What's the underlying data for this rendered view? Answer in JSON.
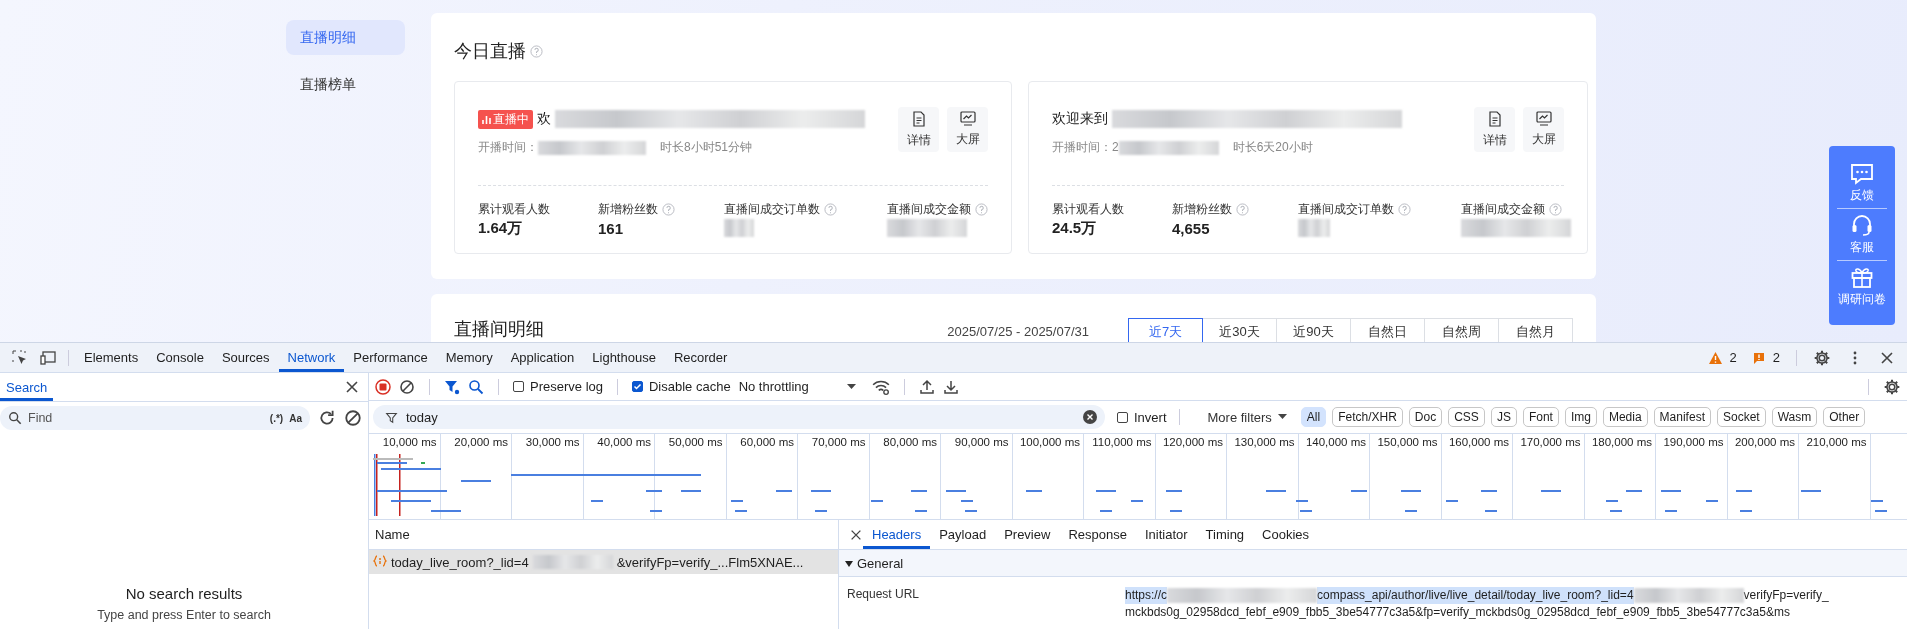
{
  "sidebar": {
    "items": [
      {
        "label": "直播明细",
        "selected": true
      },
      {
        "label": "直播榜单",
        "selected": false
      }
    ]
  },
  "today_live": {
    "title": "今日直播",
    "rooms": [
      {
        "live_badge": "直播中",
        "title": "欢",
        "start_label": "开播时间：",
        "duration": "时长8小时51分钟",
        "actions": [
          {
            "label": "详情",
            "kind": "detail"
          },
          {
            "label": "大屏",
            "kind": "screen"
          }
        ],
        "stats": [
          {
            "label": "累计观看人数",
            "value": "1.64万",
            "help": false
          },
          {
            "label": "新增粉丝数",
            "value": "161",
            "help": true
          },
          {
            "label": "直播间成交订单数",
            "help": true
          },
          {
            "label": "直播间成交金额",
            "help": true
          }
        ]
      },
      {
        "title": "欢迎来到",
        "start_label": "开播时间：2",
        "duration": "时长6天20小时",
        "actions": [
          {
            "label": "详情",
            "kind": "detail"
          },
          {
            "label": "大屏",
            "kind": "screen"
          }
        ],
        "stats": [
          {
            "label": "累计观看人数",
            "value": "24.5万",
            "help": false
          },
          {
            "label": "新增粉丝数",
            "value": "4,655",
            "help": true
          },
          {
            "label": "直播间成交订单数",
            "help": true
          },
          {
            "label": "直播间成交金额",
            "help": true
          }
        ]
      }
    ]
  },
  "live_detail": {
    "title": "直播间明细",
    "date_range": "2025/07/25 - 2025/07/31",
    "ranges": [
      {
        "label": "近7天",
        "selected": true
      },
      {
        "label": "近30天",
        "selected": false
      },
      {
        "label": "近90天",
        "selected": false
      },
      {
        "label": "自然日",
        "selected": false
      },
      {
        "label": "自然周",
        "selected": false
      },
      {
        "label": "自然月",
        "selected": false
      }
    ]
  },
  "float_bar": {
    "items": [
      {
        "label": "反馈",
        "kind": "chat"
      },
      {
        "label": "客服",
        "kind": "headset"
      },
      {
        "label": "调研问卷",
        "kind": "gift"
      }
    ]
  },
  "devtools": {
    "tabs": [
      {
        "label": "Elements",
        "selected": false
      },
      {
        "label": "Console",
        "selected": false
      },
      {
        "label": "Sources",
        "selected": false
      },
      {
        "label": "Network",
        "selected": true
      },
      {
        "label": "Performance",
        "selected": false
      },
      {
        "label": "Memory",
        "selected": false
      },
      {
        "label": "Application",
        "selected": false
      },
      {
        "label": "Lighthouse",
        "selected": false
      },
      {
        "label": "Recorder",
        "selected": false
      }
    ],
    "warnings": "2",
    "issues": "2",
    "search": {
      "tab": "Search",
      "placeholder": "Find",
      "regex": "(.*)",
      "case": "Aa",
      "empty_title": "No search results",
      "empty_hint": "Type and press Enter to search"
    },
    "toolbar": {
      "recording": true,
      "preserve_log": {
        "label": "Preserve log",
        "checked": false
      },
      "disable_cache": {
        "label": "Disable cache",
        "checked": true
      },
      "throttling": "No throttling"
    },
    "filter": {
      "value": "today",
      "invert": {
        "label": "Invert",
        "checked": false
      },
      "more_filters": "More filters",
      "types": [
        {
          "label": "All",
          "selected": true
        },
        {
          "label": "Fetch/XHR",
          "selected": false
        },
        {
          "label": "Doc",
          "selected": false
        },
        {
          "label": "CSS",
          "selected": false
        },
        {
          "label": "JS",
          "selected": false
        },
        {
          "label": "Font",
          "selected": false
        },
        {
          "label": "Img",
          "selected": false
        },
        {
          "label": "Media",
          "selected": false
        },
        {
          "label": "Manifest",
          "selected": false
        },
        {
          "label": "Socket",
          "selected": false
        },
        {
          "label": "Wasm",
          "selected": false
        },
        {
          "label": "Other",
          "selected": false
        }
      ]
    },
    "timeline": {
      "ticks": [
        "10,000 ms",
        "20,000 ms",
        "30,000 ms",
        "40,000 ms",
        "50,000 ms",
        "60,000 ms",
        "70,000 ms",
        "80,000 ms",
        "90,000 ms",
        "100,000 ms",
        "110,000 ms",
        "120,000 ms",
        "130,000 ms",
        "140,000 ms",
        "150,000 ms",
        "160,000 ms",
        "170,000 ms",
        "180,000 ms",
        "190,000 ms",
        "200,000 ms",
        "210,000 ms"
      ]
    },
    "requests": {
      "column": "Name",
      "rows": [
        {
          "name_start": "today_live_room?_lid=4",
          "name_end": "&verifyFp=verify_...Flm5XNAE...",
          "selected": true
        }
      ]
    },
    "details": {
      "tabs": [
        {
          "label": "Headers",
          "selected": true
        },
        {
          "label": "Payload",
          "selected": false
        },
        {
          "label": "Preview",
          "selected": false
        },
        {
          "label": "Response",
          "selected": false
        },
        {
          "label": "Initiator",
          "selected": false
        },
        {
          "label": "Timing",
          "selected": false
        },
        {
          "label": "Cookies",
          "selected": false
        }
      ],
      "sections": [
        {
          "title": "General",
          "expanded": true,
          "fields": [
            {
              "label": "Request URL",
              "value_parts": [
                "https://c",
                "compass_api/author/live/live_detail/today_live_room?_lid=4",
                "verifyFp=verify_"
              ],
              "value_more": "mckbds0g_02958dcd_febf_e909_fbb5_3be54777c3a5&fp=verify_mckbds0g_02958dcd_febf_e909_fbb5_3be54777c3a5&ms"
            }
          ]
        }
      ]
    }
  }
}
